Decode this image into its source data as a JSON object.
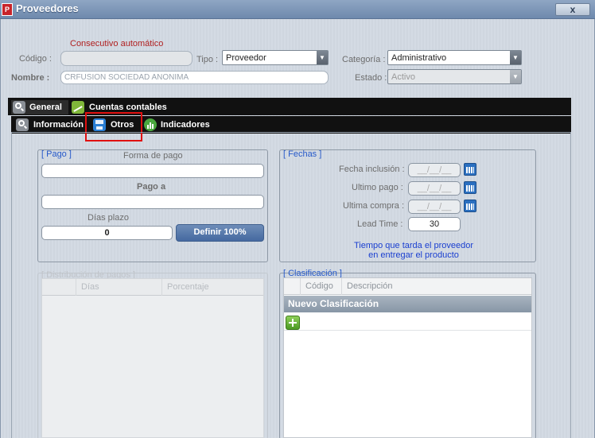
{
  "window": {
    "title": "Proveedores",
    "close_label": "x"
  },
  "header": {
    "consecutivo_note": "Consecutivo automático",
    "codigo_label": "Código :",
    "codigo_value": "",
    "tipo_label": "Tipo :",
    "tipo_value": "Proveedor",
    "categoria_label": "Categoría :",
    "categoria_value": "Administrativo",
    "nombre_label": "Nombre :",
    "nombre_value": "CRFUSION SOCIEDAD ANONIMA",
    "estado_label": "Estado :",
    "estado_value": "Activo"
  },
  "tabs_main": [
    {
      "label": "General"
    },
    {
      "label": "Cuentas contables"
    }
  ],
  "tabs_sub": [
    {
      "label": "Información"
    },
    {
      "label": "Otros"
    },
    {
      "label": "Indicadores"
    }
  ],
  "pago": {
    "title": "[ Pago ]",
    "forma_label": "Forma de pago",
    "forma_value": "",
    "pago_a_label": "Pago a",
    "pago_a_value": "",
    "dias_label": "Días plazo",
    "dias_value": "0",
    "definir_label": "Definir 100%"
  },
  "fechas": {
    "title": "[ Fechas ]",
    "inclusion_label": "Fecha inclusión :",
    "inclusion_value": "__/__/__",
    "ultimo_pago_label": "Ultimo pago :",
    "ultimo_pago_value": "__/__/__",
    "ultima_compra_label": "Ultima compra :",
    "ultima_compra_value": "__/__/__",
    "lead_label": "Lead Time :",
    "lead_value": "30",
    "note_line1": "Tiempo que tarda el proveedor",
    "note_line2": "en entregar el producto"
  },
  "distribucion": {
    "title": "[ Distribución de pagos ]",
    "columns": [
      "Días",
      "Porcentaje"
    ]
  },
  "clasificacion": {
    "title": "[ Clasificación ]",
    "columns": [
      "Código",
      "Descripción"
    ],
    "new_row": "Nuevo Clasificación"
  },
  "colors": {
    "accent": "#2659c9",
    "highlight": "#e01010",
    "tabbar": "#111111"
  }
}
